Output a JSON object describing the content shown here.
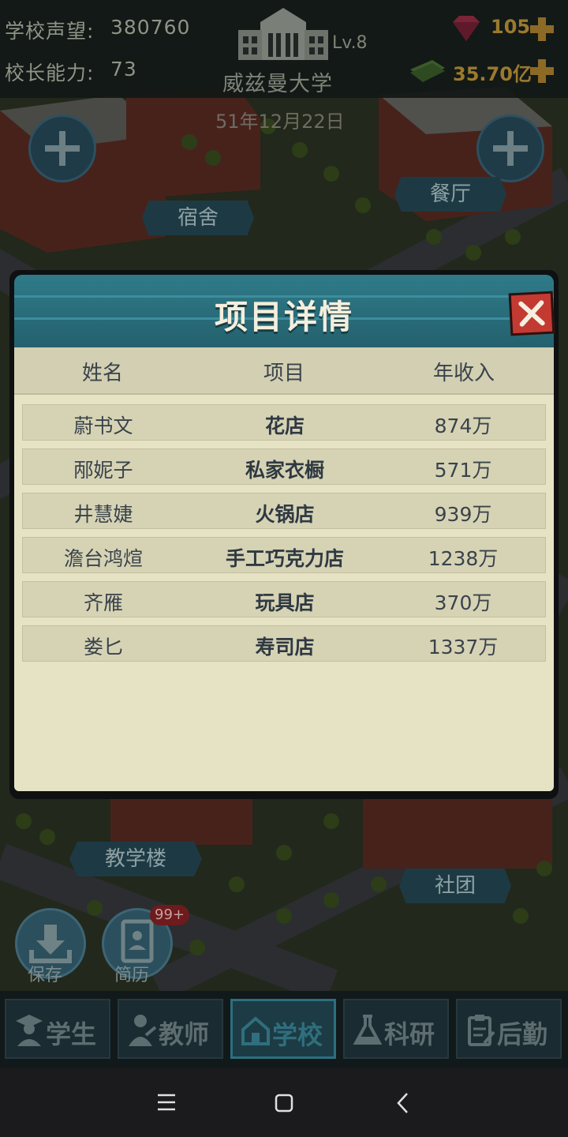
{
  "hud": {
    "reputation_label": "学校声望:",
    "reputation_value": "380760",
    "ability_label": "校长能力:",
    "ability_value": "73",
    "level": "Lv.8",
    "school_name": "威兹曼大学",
    "gems": "105",
    "money": "35.70亿",
    "date": "51年12月22日"
  },
  "map": {
    "labels": {
      "dorm": "宿舍",
      "canteen": "餐厅",
      "teaching": "教学楼",
      "club": "社团"
    },
    "save_label": "保存",
    "resume_label": "简历",
    "resume_badge": "99+"
  },
  "dialog": {
    "title": "项目详情",
    "columns": [
      "姓名",
      "项目",
      "年收入"
    ],
    "rows": [
      {
        "name": "蔚书文",
        "project": "花店",
        "income": "874万"
      },
      {
        "name": "邴妮子",
        "project": "私家衣橱",
        "income": "571万"
      },
      {
        "name": "井慧婕",
        "project": "火锅店",
        "income": "939万"
      },
      {
        "name": "澹台鸿煊",
        "project": "手工巧克力店",
        "income": "1238万"
      },
      {
        "name": "齐雁",
        "project": "玩具店",
        "income": "370万"
      },
      {
        "name": "娄匕",
        "project": "寿司店",
        "income": "1337万"
      }
    ]
  },
  "tabs": [
    {
      "label": "学生",
      "icon": "student-icon"
    },
    {
      "label": "教师",
      "icon": "teacher-icon"
    },
    {
      "label": "学校",
      "icon": "school-icon"
    },
    {
      "label": "科研",
      "icon": "flask-icon"
    },
    {
      "label": "后勤",
      "icon": "clipboard-icon"
    }
  ],
  "colors": {
    "dialog_header": "#2f7b89",
    "dialog_body": "#e6e3c4",
    "close_button": "#c33a32",
    "active_tab_border": "#2c6f80"
  }
}
